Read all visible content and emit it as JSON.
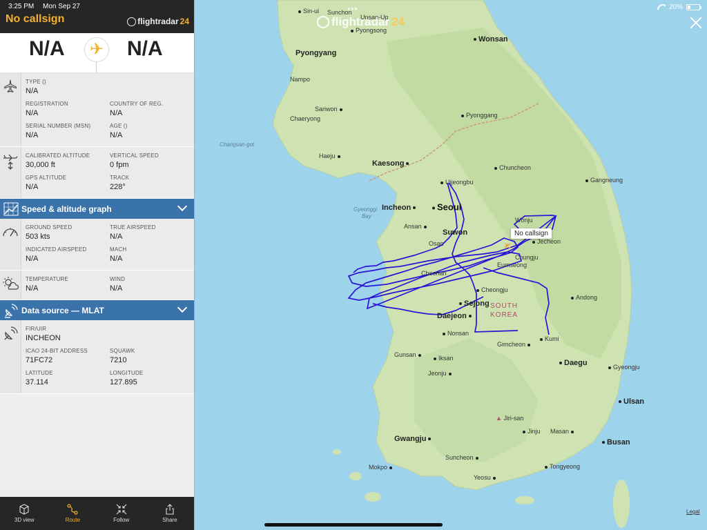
{
  "status_bar": {
    "time": "3:25 PM",
    "date": "Mon Sep 27",
    "battery": "20%",
    "battery_level": 0.2
  },
  "panel": {
    "callsign": "No callsign",
    "logo": {
      "word": "flightradar",
      "num": "24"
    },
    "route": {
      "origin": "N/A",
      "destination": "N/A"
    },
    "aircraft": {
      "type_label": "TYPE ()",
      "type_value": "N/A",
      "registration_label": "REGISTRATION",
      "registration_value": "N/A",
      "country_label": "COUNTRY OF REG.",
      "country_value": "N/A",
      "msn_label": "SERIAL NUMBER (MSN)",
      "msn_value": "N/A",
      "age_label": "AGE ()",
      "age_value": "N/A"
    },
    "altitude": {
      "cal_alt_label": "CALIBRATED ALTITUDE",
      "cal_alt_value": "30,000 ft",
      "vs_label": "VERTICAL SPEED",
      "vs_value": "0 fpm",
      "gps_alt_label": "GPS ALTITUDE",
      "gps_alt_value": "N/A",
      "track_label": "TRACK",
      "track_value": "228°"
    },
    "graph_bar": "Speed & altitude graph",
    "speed": {
      "gs_label": "GROUND SPEED",
      "gs_value": "503 kts",
      "tas_label": "TRUE AIRSPEED",
      "tas_value": "N/A",
      "ias_label": "INDICATED AIRSPEED",
      "ias_value": "N/A",
      "mach_label": "MACH",
      "mach_value": "N/A"
    },
    "weather": {
      "temp_label": "TEMPERATURE",
      "temp_value": "N/A",
      "wind_label": "WIND",
      "wind_value": "N/A"
    },
    "source_bar": "Data source — MLAT",
    "source": {
      "fir_label": "FIR/UIR",
      "fir_value": "INCHEON",
      "icao_label": "ICAO 24-BIT ADDRESS",
      "icao_value": "71FC72",
      "squawk_label": "SQUAWK",
      "squawk_value": "7210",
      "lat_label": "LATITUDE",
      "lat_value": "37.114",
      "lon_label": "LONGITUDE",
      "lon_value": "127.895"
    },
    "tabs": [
      {
        "label": "3D view",
        "icon": "cube-icon"
      },
      {
        "label": "Route",
        "icon": "route-icon",
        "active": true
      },
      {
        "label": "Follow",
        "icon": "follow-icon"
      },
      {
        "label": "Share",
        "icon": "share-icon"
      }
    ]
  },
  "map": {
    "logo": {
      "word": "flightradar",
      "num": "24"
    },
    "tooltip": "No callsign",
    "legal": "Legal",
    "country_label": [
      "SOUTH",
      "KOREA"
    ],
    "water_labels": [
      "Changsan-got",
      "Gyeonggi",
      "Bay"
    ],
    "cities": {
      "sinuiju": "Sin-ui",
      "sunchon": "Sunchon",
      "unsan": "Unsan-Up",
      "pyongsong": "Pyongsong",
      "wonsan": "Wonsan",
      "pyongyang": "Pyongyang",
      "nampo": "Nampo",
      "sariwon": "Sariwon",
      "chaeryong": "Chaeryong",
      "pyonggang": "Pyonggang",
      "haeju": "Haeju",
      "kaesong": "Kaesong",
      "chuncheon": "Chuncheon",
      "gangneung": "Gangneung",
      "uijeongbu": "Uijeongbu",
      "incheon": "Incheon",
      "seoul": "Seoul",
      "ansan": "Ansan",
      "suwon": "Suwon",
      "osan": "Osan",
      "wonju": "Wonju",
      "jecheon": "Jecheon",
      "chungju": "Chungju",
      "eumseong": "Eumseong",
      "cheonan": "Cheonan",
      "cheongju": "Cheongju",
      "sejong": "Sejong",
      "daejeon": "Daejeon",
      "andong": "Andong",
      "nonsan": "Nonsan",
      "gimcheon": "Gimcheon",
      "kumi": "Kumi",
      "gunsan": "Gunsan",
      "iksan": "Iksan",
      "jeonju": "Jeonju",
      "daegu": "Daegu",
      "gyeongju": "Gyeongju",
      "ulsan": "Ulsan",
      "jirisan": "Jiri-san",
      "jinju": "Jinju",
      "masan": "Masan",
      "busan": "Busan",
      "gwangju": "Gwangju",
      "suncheon": "Suncheon",
      "mokpo": "Mokpo",
      "yeosu": "Yeosu",
      "tongyeong": "Tongyeong"
    }
  }
}
